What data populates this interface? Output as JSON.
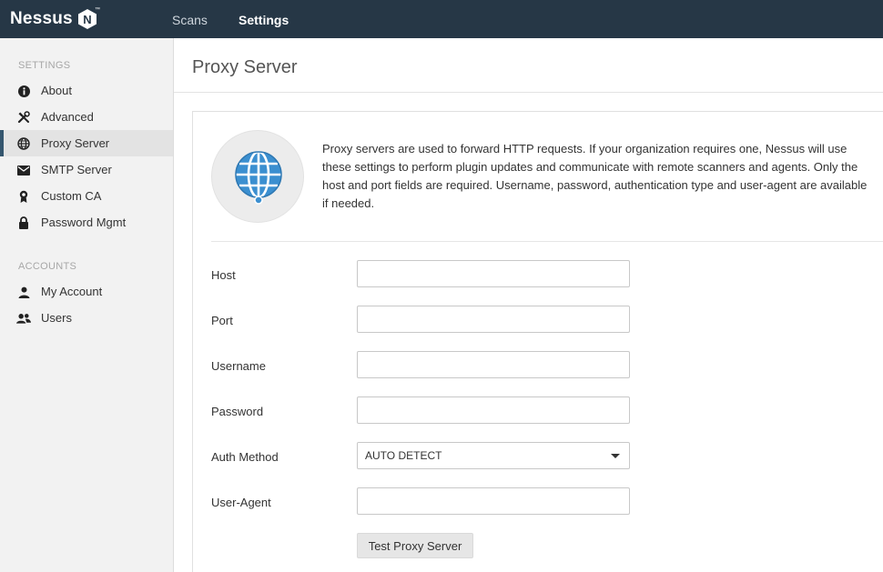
{
  "app": {
    "logo_text": "Nessus",
    "logo_badge": "N",
    "logo_tm": "™"
  },
  "topnav": {
    "scans": "Scans",
    "settings": "Settings"
  },
  "sidebar": {
    "settings_heading": "SETTINGS",
    "settings_items": [
      {
        "label": "About",
        "icon": "info-icon"
      },
      {
        "label": "Advanced",
        "icon": "tools-icon"
      },
      {
        "label": "Proxy Server",
        "icon": "globe-icon",
        "active": true
      },
      {
        "label": "SMTP Server",
        "icon": "envelope-icon"
      },
      {
        "label": "Custom CA",
        "icon": "certificate-icon"
      },
      {
        "label": "Password Mgmt",
        "icon": "lock-icon"
      }
    ],
    "accounts_heading": "ACCOUNTS",
    "account_items": [
      {
        "label": "My Account",
        "icon": "user-icon"
      },
      {
        "label": "Users",
        "icon": "users-icon"
      }
    ]
  },
  "main": {
    "title": "Proxy Server",
    "intro": "Proxy servers are used to forward HTTP requests. If your organization requires one, Nessus will use these settings to perform plugin updates and communicate with remote scanners and agents. Only the host and port fields are required. Username, password, authentication type and user-agent are available if needed.",
    "form": {
      "host_label": "Host",
      "host_value": "",
      "port_label": "Port",
      "port_value": "",
      "username_label": "Username",
      "username_value": "",
      "password_label": "Password",
      "password_value": "",
      "auth_label": "Auth Method",
      "auth_value": "AUTO DETECT",
      "useragent_label": "User-Agent",
      "useragent_value": ""
    },
    "test_button": "Test Proxy Server"
  },
  "colors": {
    "topbar": "#263746",
    "sidebar_bg": "#f2f2f2",
    "active_accent": "#34566e",
    "globe_blue": "#3b8fd0"
  }
}
